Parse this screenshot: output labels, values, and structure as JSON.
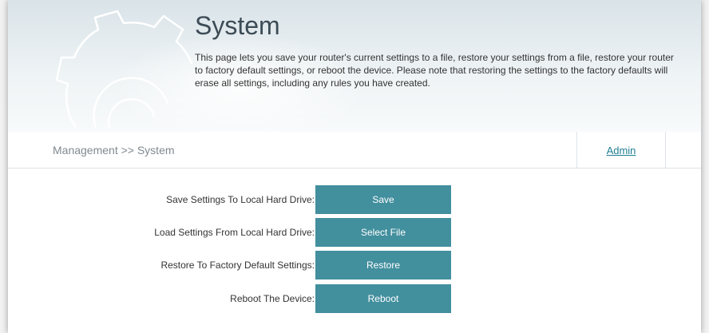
{
  "header": {
    "title": "System",
    "description": "This page lets you save your router's current settings to a file, restore your settings from a file, restore your router to factory default settings, or reboot the device. Please note that restoring the settings to the factory defaults will erase all settings, including any rules you have created.",
    "icon": "gear-icon"
  },
  "nav": {
    "breadcrumb": "Management >> System",
    "admin_link": "Admin"
  },
  "actions": [
    {
      "label": "Save Settings To Local Hard Drive:",
      "button": "Save"
    },
    {
      "label": "Load Settings From Local Hard Drive:",
      "button": "Select File"
    },
    {
      "label": "Restore To Factory Default Settings:",
      "button": "Restore"
    },
    {
      "label": "Reboot The Device:",
      "button": "Reboot"
    }
  ],
  "colors": {
    "button_bg": "#428f9e",
    "link": "#1f7f92",
    "title": "#3c4b55"
  }
}
